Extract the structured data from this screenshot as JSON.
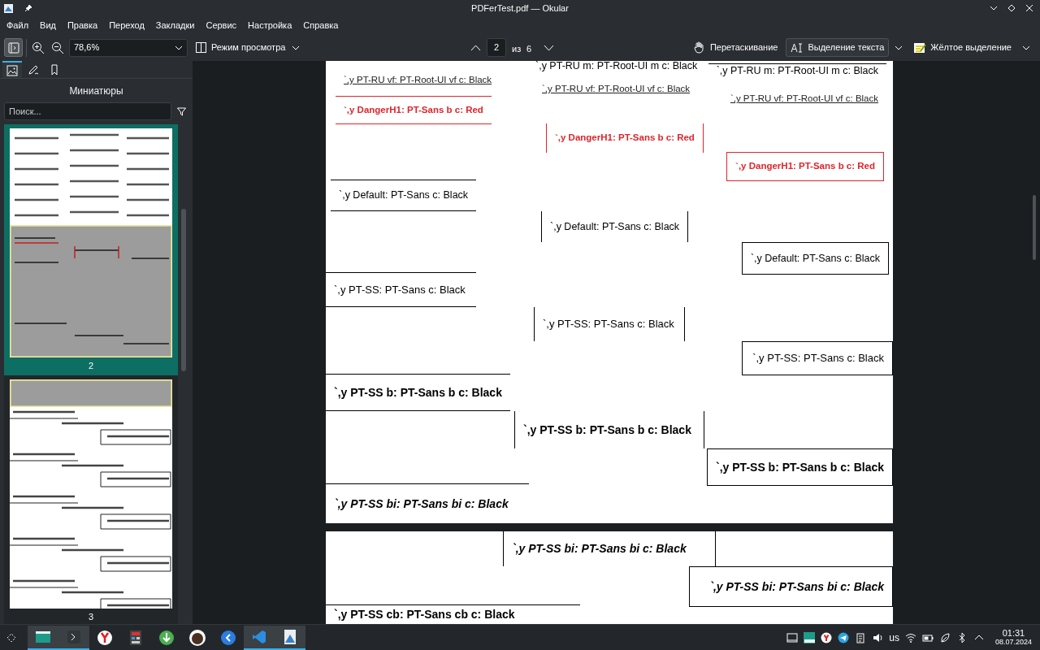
{
  "window": {
    "title": "PDFerTest.pdf — Okular"
  },
  "menu": [
    "Файл",
    "Вид",
    "Правка",
    "Переход",
    "Закладки",
    "Сервис",
    "Настройка",
    "Справка"
  ],
  "toolbar": {
    "sidebar_toggle": {
      "checked": true
    },
    "zoom": "78,6%",
    "view_mode": "Режим просмотра",
    "page": "2",
    "of_label": "из",
    "page_count": "6",
    "tools": [
      {
        "kind": "hand",
        "label": "Перетаскивание",
        "selected": false
      },
      {
        "kind": "text-select",
        "label": "Выделение текста",
        "selected": true
      },
      {
        "kind": "highlighter",
        "label": "Жёлтое выделение",
        "selected": false
      }
    ]
  },
  "sidebar": {
    "tabs": [
      {
        "kind": "thumbnails",
        "selected": true
      },
      {
        "kind": "annotations",
        "selected": false
      },
      {
        "kind": "bookmarks",
        "selected": false
      }
    ],
    "title": "Миниатюры",
    "search": {
      "placeholder": "Поиск..."
    },
    "thumbnails": [
      {
        "label": "2",
        "selected": true,
        "kind": "picture"
      },
      {
        "label": "3",
        "selected": false,
        "kind": "picture"
      }
    ]
  },
  "pages": [
    {
      "items": [
        {
          "text": "`,y PT-RU m: PT-Root-UI m c: Black",
          "kind": "plain"
        },
        {
          "text": "`,y PT-RU m: PT-Root-UI m c: Black",
          "kind": "overline"
        },
        {
          "text": "`,y PT-RU vf: PT-Root-UI vf c: Black",
          "kind": "plain"
        },
        {
          "text": "`,y PT-RU vf: PT-Root-UI vf c: Black",
          "kind": "plain"
        },
        {
          "text": "`,y PT-RU vf: PT-Root-UI vf c: Black",
          "kind": "plain"
        },
        {
          "text": "`,y DangerH1: PT-Sans b c: Red",
          "kind": "rules"
        },
        {
          "text": "`,y DangerH1: PT-Sans b c: Red",
          "kind": "bars"
        },
        {
          "text": "`,y DangerH1: PT-Sans b c: Red",
          "kind": "box"
        },
        {
          "text": "`,y Default: PT-Sans  c: Black",
          "kind": "rules"
        },
        {
          "text": "`,y Default: PT-Sans  c: Black",
          "kind": "bars"
        },
        {
          "text": "`,y Default: PT-Sans  c: Black",
          "kind": "box"
        },
        {
          "text": "`,y PT-SS: PT-Sans  c: Black",
          "kind": "rules"
        },
        {
          "text": "`,y PT-SS: PT-Sans  c: Black",
          "kind": "bars"
        },
        {
          "text": "`,y PT-SS: PT-Sans  c: Black",
          "kind": "box"
        },
        {
          "text": "`,y PT-SS b: PT-Sans b c: Black",
          "kind": "rules"
        },
        {
          "text": "`,y PT-SS b: PT-Sans b c: Black",
          "kind": "bars"
        },
        {
          "text": "`,y PT-SS b: PT-Sans b c: Black",
          "kind": "box"
        },
        {
          "text": "`,y PT-SS bi: PT-Sans bi c: Black",
          "kind": "overline"
        }
      ]
    },
    {
      "items": [
        {
          "text": "`,y PT-SS bi: PT-Sans bi c: Black",
          "kind": "bars"
        },
        {
          "text": "`,y PT-SS bi: PT-Sans bi c: Black",
          "kind": "box"
        },
        {
          "text": "`,y PT-SS cb: PT-Sans cb c: Black",
          "kind": "overline"
        }
      ]
    }
  ],
  "taskbar": {
    "apps": [
      {
        "kind": "files",
        "active": true
      },
      {
        "kind": "terminal",
        "active": true
      },
      {
        "kind": "browser",
        "active": false
      },
      {
        "kind": "calculator",
        "active": false
      },
      {
        "kind": "download",
        "active": false
      },
      {
        "kind": "avatar",
        "active": false
      },
      {
        "kind": "remote",
        "active": false
      },
      {
        "kind": "editor",
        "active": true
      },
      {
        "kind": "viewer",
        "active": true
      }
    ],
    "tray": [
      {
        "kind": "window"
      },
      {
        "kind": "tile"
      },
      {
        "kind": "browser"
      },
      {
        "kind": "telegram"
      },
      {
        "kind": "clipboard"
      },
      {
        "kind": "volume"
      },
      {
        "kind": "layout",
        "label": "us"
      },
      {
        "kind": "wifi"
      },
      {
        "kind": "battery"
      },
      {
        "kind": "power"
      },
      {
        "kind": "bluetooth"
      },
      {
        "kind": "expand"
      }
    ],
    "time": "01:31",
    "date": "08.07.2024"
  }
}
